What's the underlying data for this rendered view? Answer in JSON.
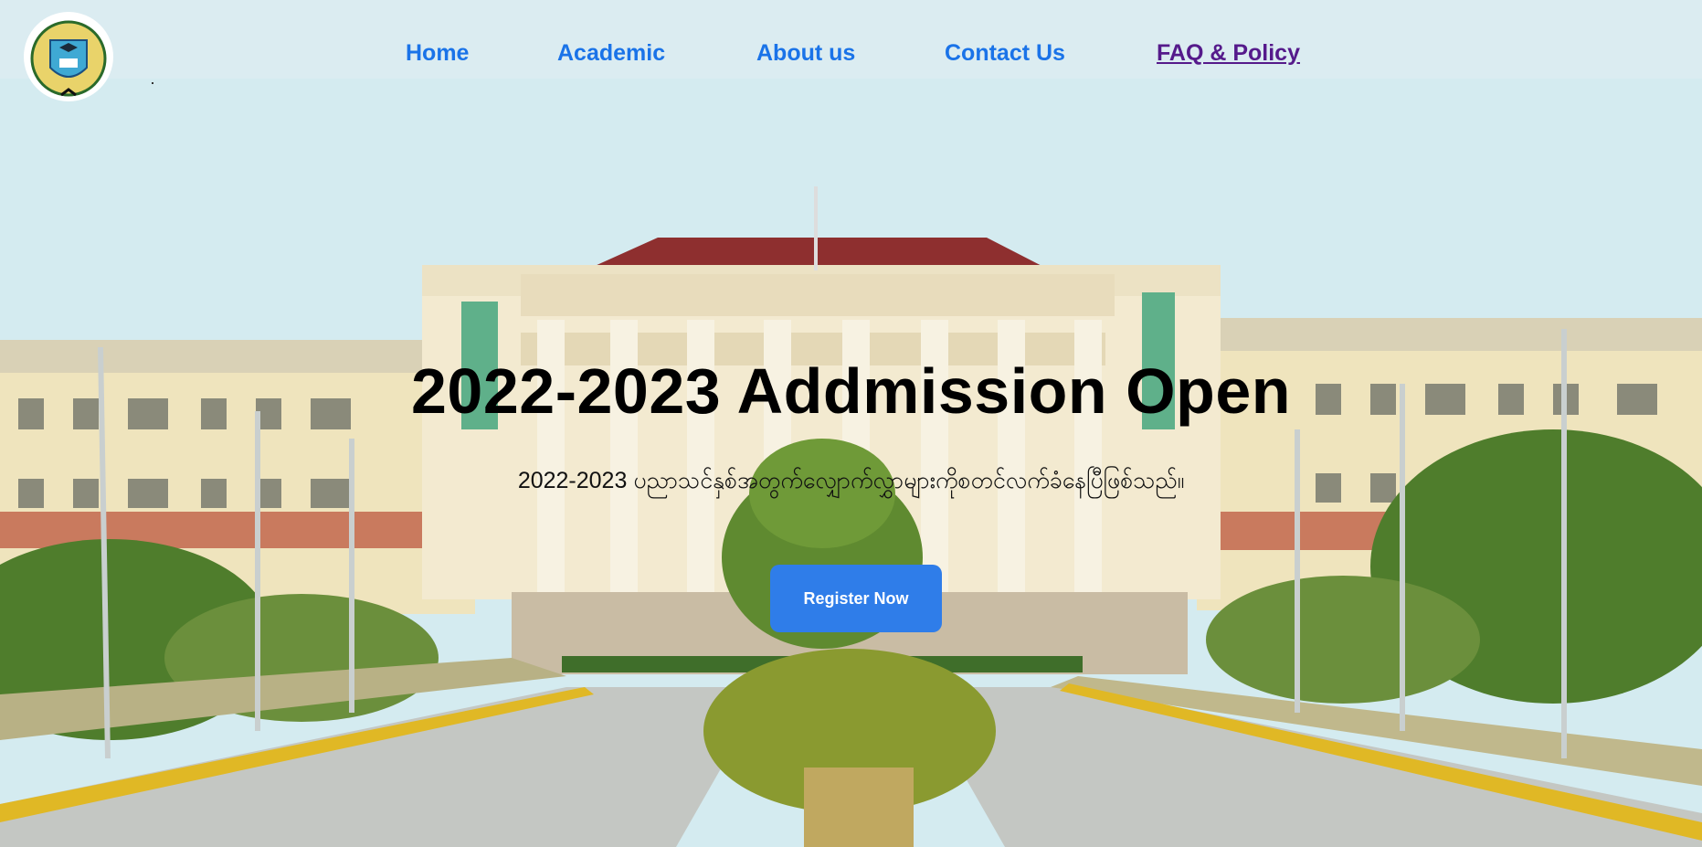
{
  "nav": {
    "home": "Home",
    "academic": "Academic",
    "about": "About us",
    "contact": "Contact Us",
    "faq": "FAQ & Policy"
  },
  "hero": {
    "title": "2022-2023 Addmission Open",
    "subtitle": "2022-2023 ပညာသင်နှစ်အတွက်လျှောက်လွှာများကိုစတင်လက်ခံနေပြီဖြစ်သည်။",
    "register_label": "Register Now"
  },
  "icons": {
    "logo": "university-crest-logo"
  },
  "colors": {
    "nav_link": "#1a73e8",
    "nav_link_visited": "#551a8b",
    "register_button": "#2f7de9",
    "roof": "#8e2f2f",
    "building_wall": "#f2e6b8"
  }
}
